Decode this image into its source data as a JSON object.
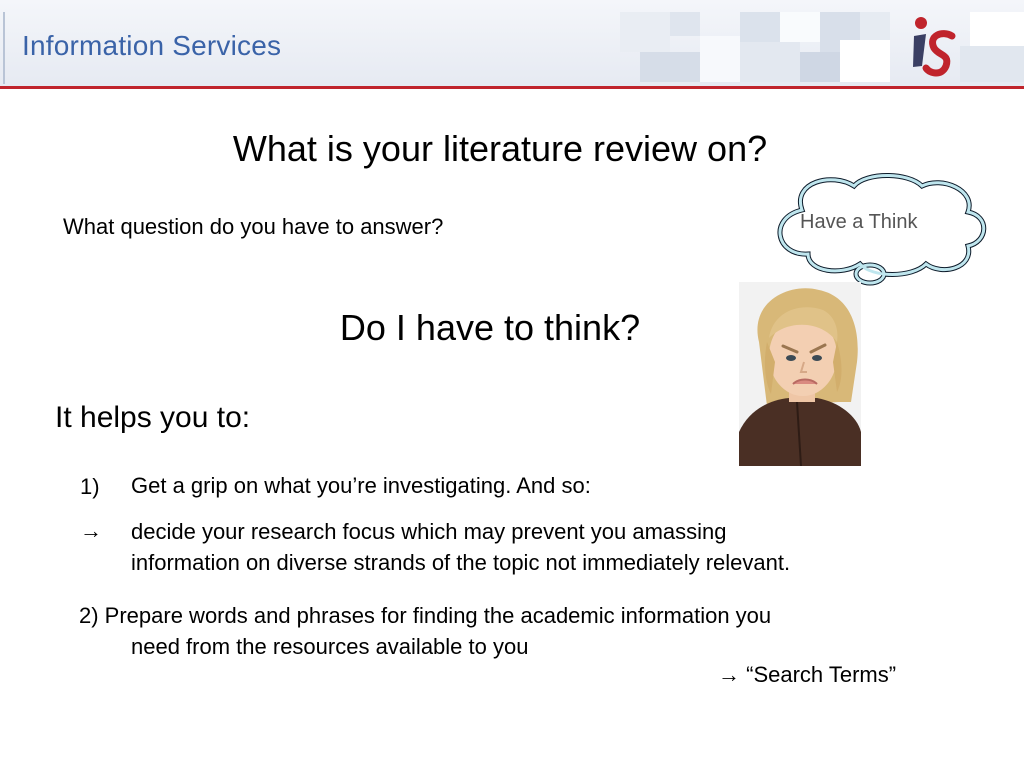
{
  "header": {
    "title": "Information Services",
    "logo_text": "is",
    "accent_color": "#c0242c",
    "title_color": "#3a63a8"
  },
  "slide": {
    "title": "What is your literature review on?",
    "question": "What question do you have to answer?",
    "subtitle": "Do I have to think?",
    "helps_heading": "It helps you to:",
    "item1_marker": "1)",
    "item1_text": "Get a grip on what you’re investigating. And so:",
    "arrow_marker": "→",
    "arrow_text_line1": "decide your research focus which may prevent you amassing",
    "arrow_text_line2": "information on diverse strands of the topic not immediately relevant.",
    "item2_line1": "2) Prepare words and phrases for finding the academic information you",
    "item2_line2": "need from the resources available to you",
    "search_terms": "→ “Search Terms”"
  },
  "cloud": {
    "text": "Have a Think"
  }
}
